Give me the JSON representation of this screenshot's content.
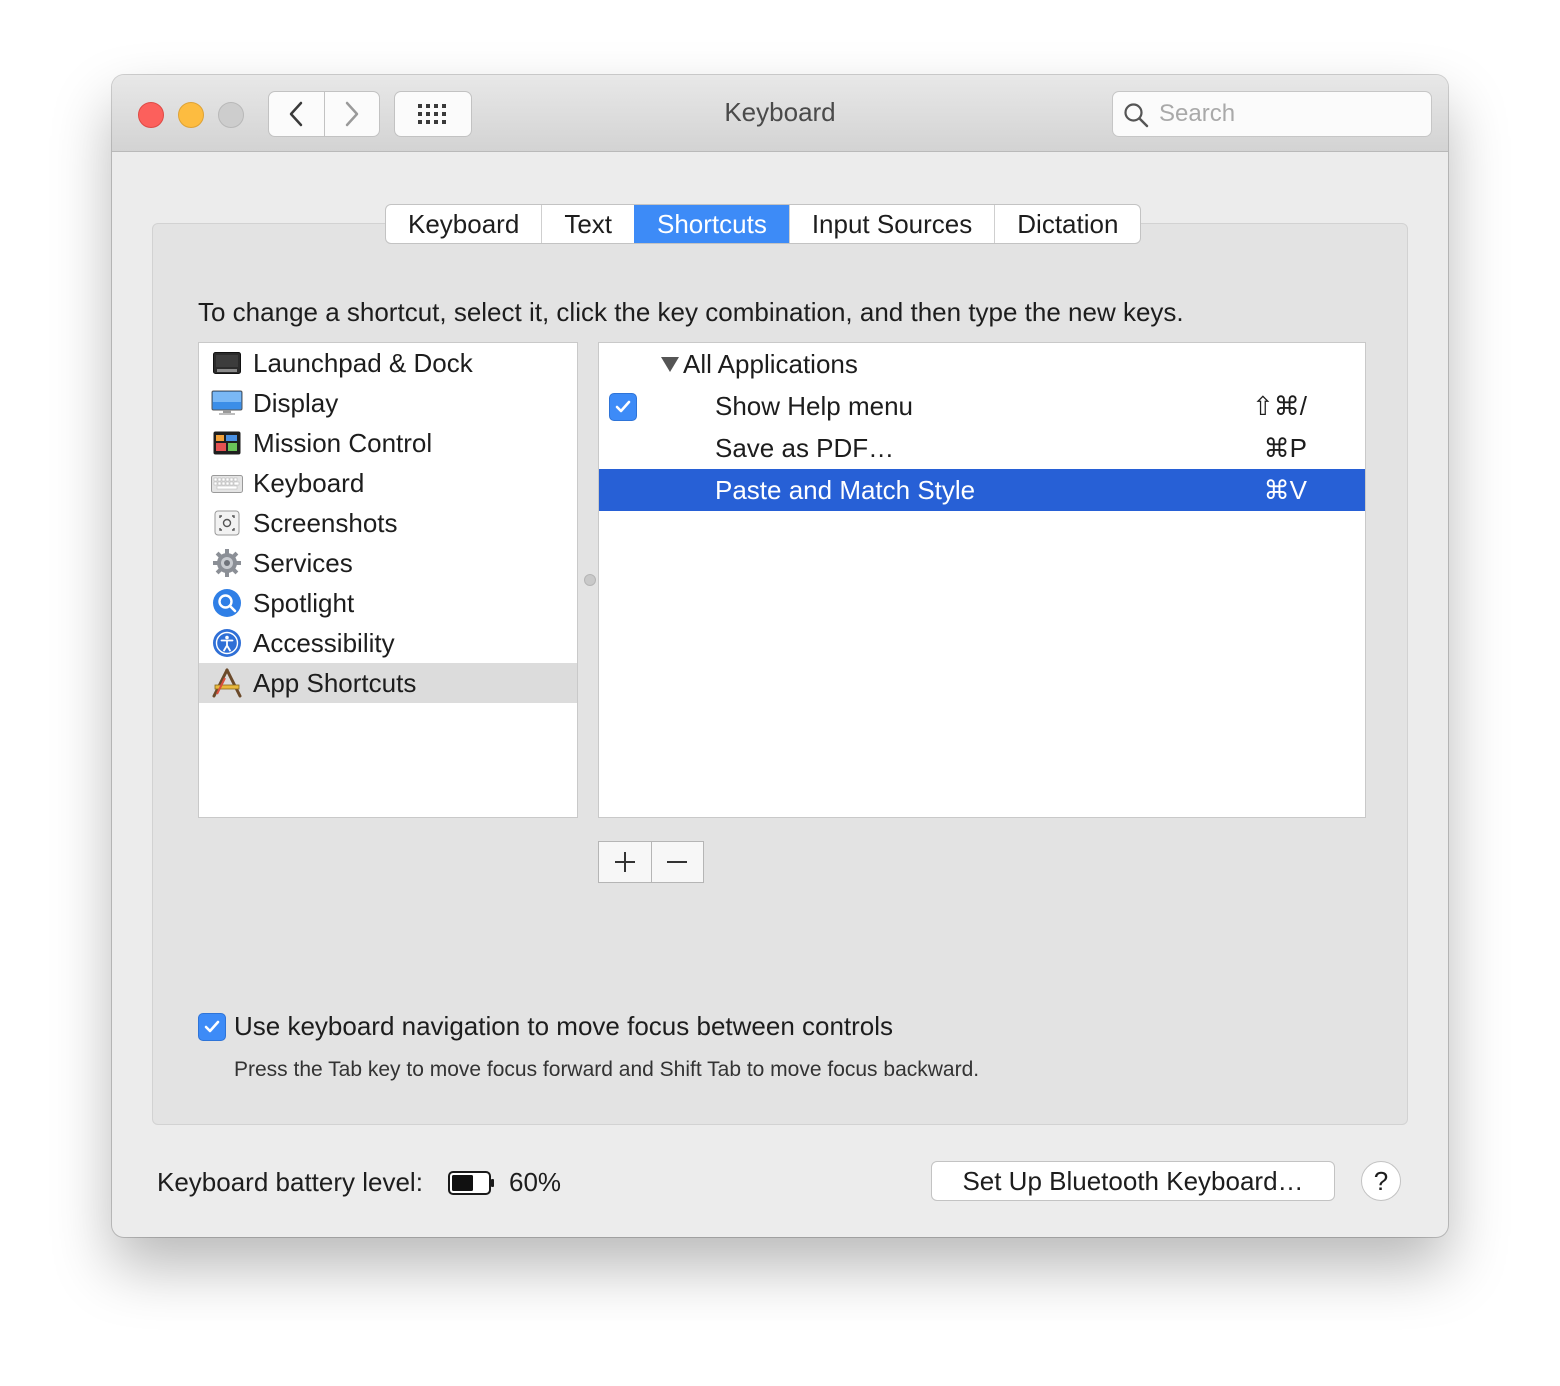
{
  "window": {
    "title": "Keyboard"
  },
  "search": {
    "placeholder": "Search"
  },
  "tabs": [
    "Keyboard",
    "Text",
    "Shortcuts",
    "Input Sources",
    "Dictation"
  ],
  "active_tab": "Shortcuts",
  "instruction": "To change a shortcut, select it, click the key combination, and then type the new keys.",
  "categories": [
    {
      "label": "Launchpad & Dock",
      "icon": "launchpad-dock-icon"
    },
    {
      "label": "Display",
      "icon": "display-icon"
    },
    {
      "label": "Mission Control",
      "icon": "mission-control-icon"
    },
    {
      "label": "Keyboard",
      "icon": "keyboard-icon"
    },
    {
      "label": "Screenshots",
      "icon": "screenshots-icon"
    },
    {
      "label": "Services",
      "icon": "services-gear-icon"
    },
    {
      "label": "Spotlight",
      "icon": "spotlight-icon"
    },
    {
      "label": "Accessibility",
      "icon": "accessibility-icon"
    },
    {
      "label": "App Shortcuts",
      "icon": "app-shortcuts-icon",
      "selected": true
    }
  ],
  "shortcuts": {
    "group": "All Applications",
    "items": [
      {
        "label": "Show Help menu",
        "keys": "⇧⌘/",
        "checked": true
      },
      {
        "label": "Save as PDF…",
        "keys": "⌘P"
      },
      {
        "label": "Paste and Match Style",
        "keys": "⌘V",
        "selected": true
      }
    ]
  },
  "buttons": {
    "add": "+",
    "remove": "−"
  },
  "keyboard_navigation": {
    "label": "Use keyboard navigation to move focus between controls",
    "hint": "Press the Tab key to move focus forward and Shift Tab to move focus backward.",
    "checked": true
  },
  "battery": {
    "label": "Keyboard battery level:",
    "percent": "60%",
    "level": 0.6
  },
  "bluetooth_button": "Set Up Bluetooth Keyboard…",
  "help": "?",
  "colors": {
    "accent": "#3d8bf7",
    "selection": "#2760d6",
    "red": "#fc605c",
    "yellow": "#fdbc40"
  }
}
